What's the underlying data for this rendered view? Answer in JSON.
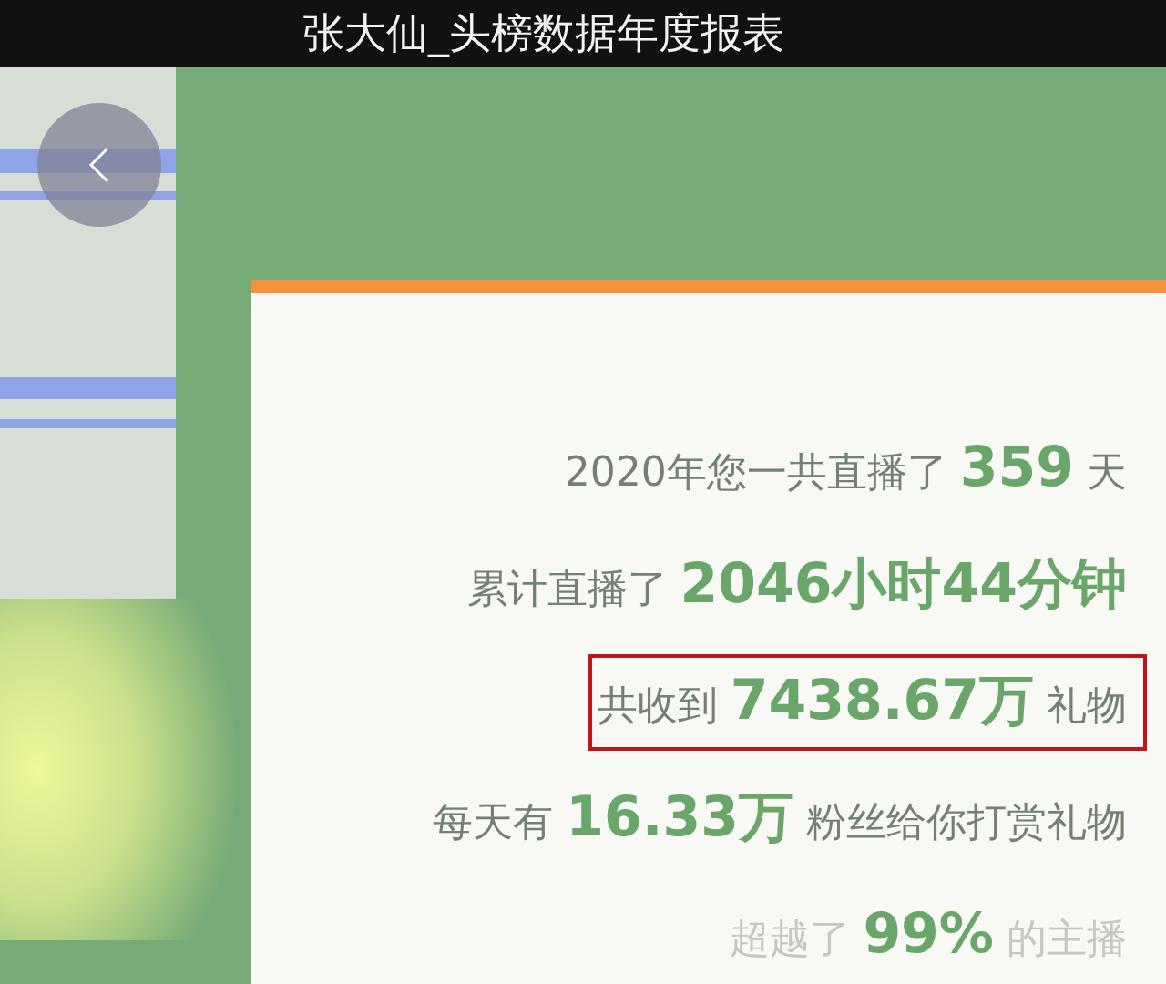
{
  "header": {
    "title": "张大仙_头榜数据年度报表"
  },
  "lines": [
    {
      "text": "2020年您一共直播了 **359** 天",
      "highlighted": false,
      "dim": false
    },
    {
      "text": "累计直播了 **2046小时44分钟**",
      "highlighted": false,
      "dim": false
    },
    {
      "text": "共收到 **7438.67万** 礼物",
      "highlighted": true,
      "dim": false
    },
    {
      "text": "每天有 **16.33万** 粉丝给你打赏礼物",
      "highlighted": false,
      "dim": false
    },
    {
      "text": "超越了 **99%** 的主播",
      "highlighted": false,
      "dim": true
    }
  ]
}
